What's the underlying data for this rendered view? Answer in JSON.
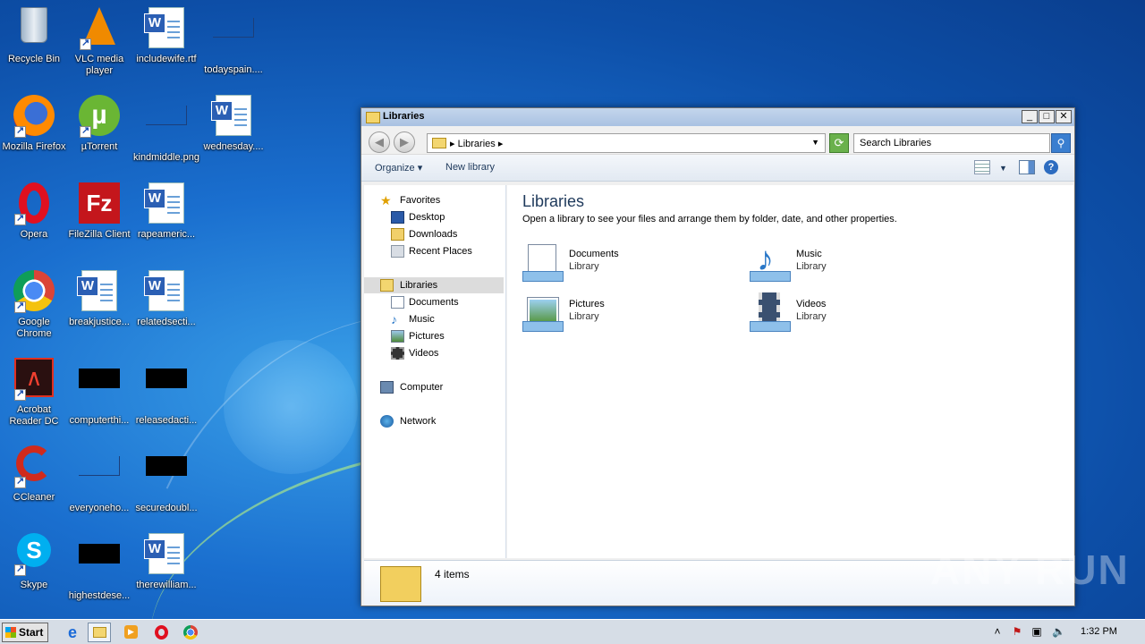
{
  "desktop": {
    "icons": [
      {
        "label": "Recycle Bin"
      },
      {
        "label": "VLC media player"
      },
      {
        "label": "includewife.rtf"
      },
      {
        "label": "todayspain...."
      },
      {
        "label": "Mozilla Firefox"
      },
      {
        "label": "µTorrent"
      },
      {
        "label": "kindmiddle.png"
      },
      {
        "label": "wednesday...."
      },
      {
        "label": "Opera"
      },
      {
        "label": "FileZilla Client"
      },
      {
        "label": "rapeameric..."
      },
      {
        "label": "Google Chrome"
      },
      {
        "label": "breakjustice..."
      },
      {
        "label": "relatedsecti..."
      },
      {
        "label": "Acrobat Reader DC"
      },
      {
        "label": "computerthi..."
      },
      {
        "label": "releasedacti..."
      },
      {
        "label": "CCleaner"
      },
      {
        "label": "everyoneho..."
      },
      {
        "label": "securedoubl..."
      },
      {
        "label": "Skype"
      },
      {
        "label": "highestdese..."
      },
      {
        "label": "therewilliam..."
      }
    ]
  },
  "window": {
    "title": "Libraries",
    "controls": {
      "minimize": "_",
      "maximize": "□",
      "close": "✕"
    },
    "address": {
      "crumb": "Libraries"
    },
    "search": {
      "placeholder": "Search Libraries"
    },
    "commands": {
      "organize": "Organize ▾",
      "new_library": "New library"
    },
    "nav": {
      "favorites": "Favorites",
      "desktop": "Desktop",
      "downloads": "Downloads",
      "recent_places": "Recent Places",
      "libraries": "Libraries",
      "documents": "Documents",
      "music": "Music",
      "pictures": "Pictures",
      "videos": "Videos",
      "computer": "Computer",
      "network": "Network"
    },
    "content": {
      "title": "Libraries",
      "subtitle": "Open a library to see your files and arrange them by folder, date, and other properties.",
      "libraries": [
        {
          "name": "Documents",
          "type": "Library"
        },
        {
          "name": "Music",
          "type": "Library"
        },
        {
          "name": "Pictures",
          "type": "Library"
        },
        {
          "name": "Videos",
          "type": "Library"
        }
      ]
    },
    "details": {
      "count": "4 items"
    }
  },
  "watermark": "ANY RUN",
  "taskbar": {
    "start": "Start",
    "clock": "1:32 PM"
  },
  "colors": {
    "accent": "#1e395b",
    "selection": "#dcdcdc"
  }
}
